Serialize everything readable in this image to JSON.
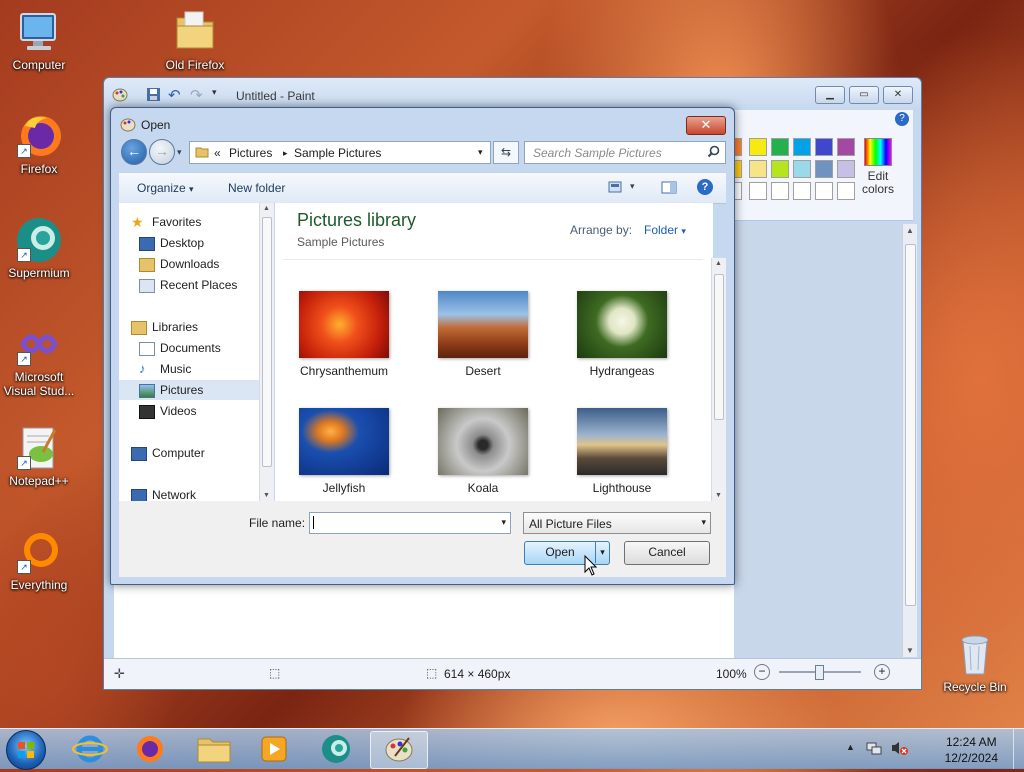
{
  "desktop": {
    "icons": [
      {
        "label": "Computer"
      },
      {
        "label": "Old Firefox"
      },
      {
        "label": "Firefox"
      },
      {
        "label": "Supermium"
      },
      {
        "label": "Microsoft Visual Stud..."
      },
      {
        "label": "Notepad++"
      },
      {
        "label": "Everything"
      },
      {
        "label": "Recycle Bin"
      }
    ]
  },
  "paint": {
    "title": "Untitled - Paint",
    "edit_colors_label": "Edit colors",
    "status": {
      "dimensions": "614 × 460px",
      "zoom": "100%"
    },
    "palette": [
      "#f6ea12",
      "#22b14c",
      "#00a2e8",
      "#3f48cc",
      "#a349a4",
      "#f7e388",
      "#b5e61d",
      "#99d9ea",
      "#7092be",
      "#c8bfe7"
    ]
  },
  "dialog": {
    "title": "Open",
    "breadcrumb": [
      "«",
      "Pictures",
      "▸",
      "Sample Pictures"
    ],
    "search_placeholder": "Search Sample Pictures",
    "toolbar": {
      "organize": "Organize",
      "new_folder": "New folder"
    },
    "nav": {
      "favorites": "Favorites",
      "desktop": "Desktop",
      "downloads": "Downloads",
      "recent": "Recent Places",
      "libraries": "Libraries",
      "documents": "Documents",
      "music": "Music",
      "pictures": "Pictures",
      "videos": "Videos",
      "computer": "Computer",
      "network": "Network"
    },
    "library_title": "Pictures library",
    "library_sub": "Sample Pictures",
    "arrange_label": "Arrange by:",
    "arrange_value": "Folder",
    "files": [
      {
        "name": "Chrysanthemum"
      },
      {
        "name": "Desert"
      },
      {
        "name": "Hydrangeas"
      },
      {
        "name": "Jellyfish"
      },
      {
        "name": "Koala"
      },
      {
        "name": "Lighthouse"
      }
    ],
    "file_name_label": "File name:",
    "file_name_value": "",
    "file_type": "All Picture Files",
    "open_label": "Open",
    "cancel_label": "Cancel"
  },
  "taskbar": {
    "time": "12:24 AM",
    "date": "12/2/2024"
  }
}
